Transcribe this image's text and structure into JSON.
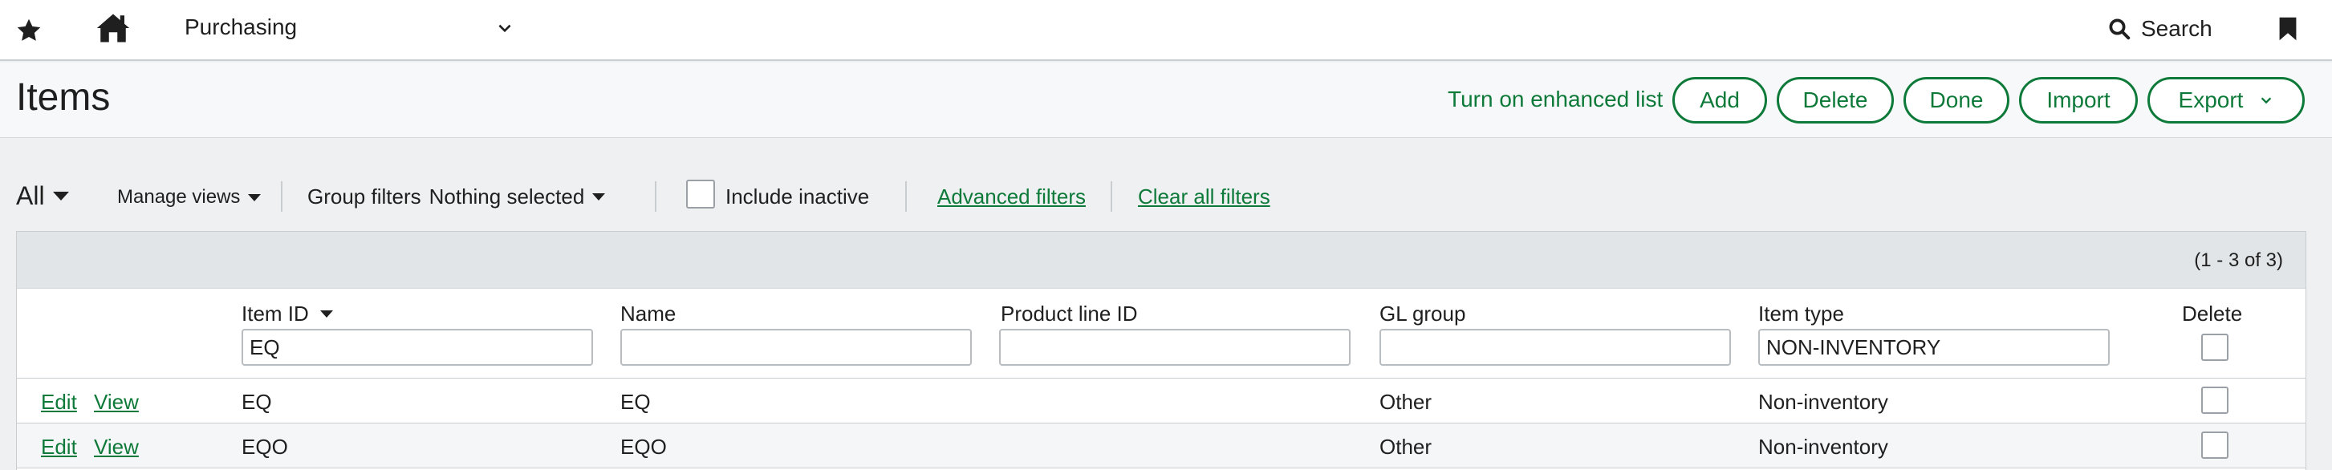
{
  "topbar": {
    "app_name": "Purchasing",
    "search_label": "Search",
    "icons": [
      "star-icon",
      "home-icon",
      "chevron-down-icon",
      "search-icon",
      "bookmark-icon"
    ]
  },
  "header": {
    "title": "Items",
    "enhanced_link": "Turn on enhanced list",
    "buttons": {
      "add": "Add",
      "delete": "Delete",
      "done": "Done",
      "import": "Import",
      "export": "Export"
    },
    "accent_color": "#0e7a3a"
  },
  "filters": {
    "view": "All",
    "manage_views": "Manage views",
    "group_filters_label": "Group filters",
    "group_filters_value": "Nothing selected",
    "include_inactive": "Include inactive",
    "include_inactive_checked": false,
    "advanced_filters": "Advanced filters",
    "clear_all_filters": "Clear all filters"
  },
  "table": {
    "count_text": "(1 - 3 of 3)",
    "columns": {
      "item_id": "Item ID",
      "name": "Name",
      "product_line_id": "Product line ID",
      "gl_group": "GL group",
      "item_type": "Item type",
      "delete": "Delete"
    },
    "column_filters": {
      "item_id": "EQ",
      "name": "",
      "product_line_id": "",
      "gl_group": "",
      "item_type": "NON-INVENTORY"
    },
    "row_actions": {
      "edit": "Edit",
      "view": "View"
    },
    "rows": [
      {
        "item_id": "EQ",
        "name": "EQ",
        "product_line_id": "",
        "gl_group": "Other",
        "item_type": "Non-inventory"
      },
      {
        "item_id": "EQO",
        "name": "EQO",
        "product_line_id": "",
        "gl_group": "Other",
        "item_type": "Non-inventory"
      }
    ]
  }
}
